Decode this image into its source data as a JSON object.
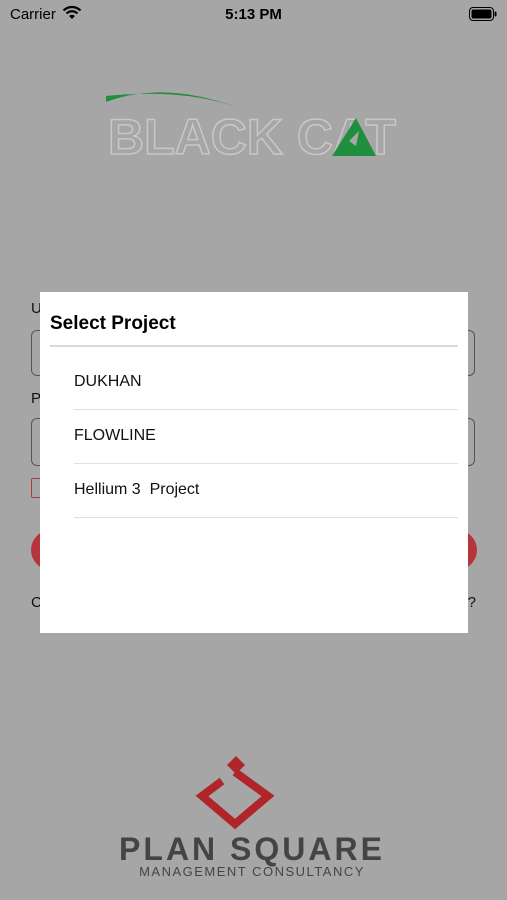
{
  "status_bar": {
    "carrier": "Carrier",
    "time": "5:13 PM"
  },
  "brand_logo": {
    "text": "BLACK CAT",
    "color": "#1f8f3e"
  },
  "login_form": {
    "username_label": "U",
    "password_label": "P",
    "left_link_text": "C",
    "right_link_text": "?",
    "button_color": "#b8343b"
  },
  "dialog": {
    "title": "Select Project",
    "projects": [
      {
        "label": "DUKHAN"
      },
      {
        "label": "FLOWLINE"
      },
      {
        "label": "Hellium 3  Project"
      }
    ]
  },
  "footer_logo": {
    "name": "PLAN SQUARE",
    "tagline": "MANAGEMENT CONSULTANCY",
    "accent_color": "#b0252a"
  }
}
